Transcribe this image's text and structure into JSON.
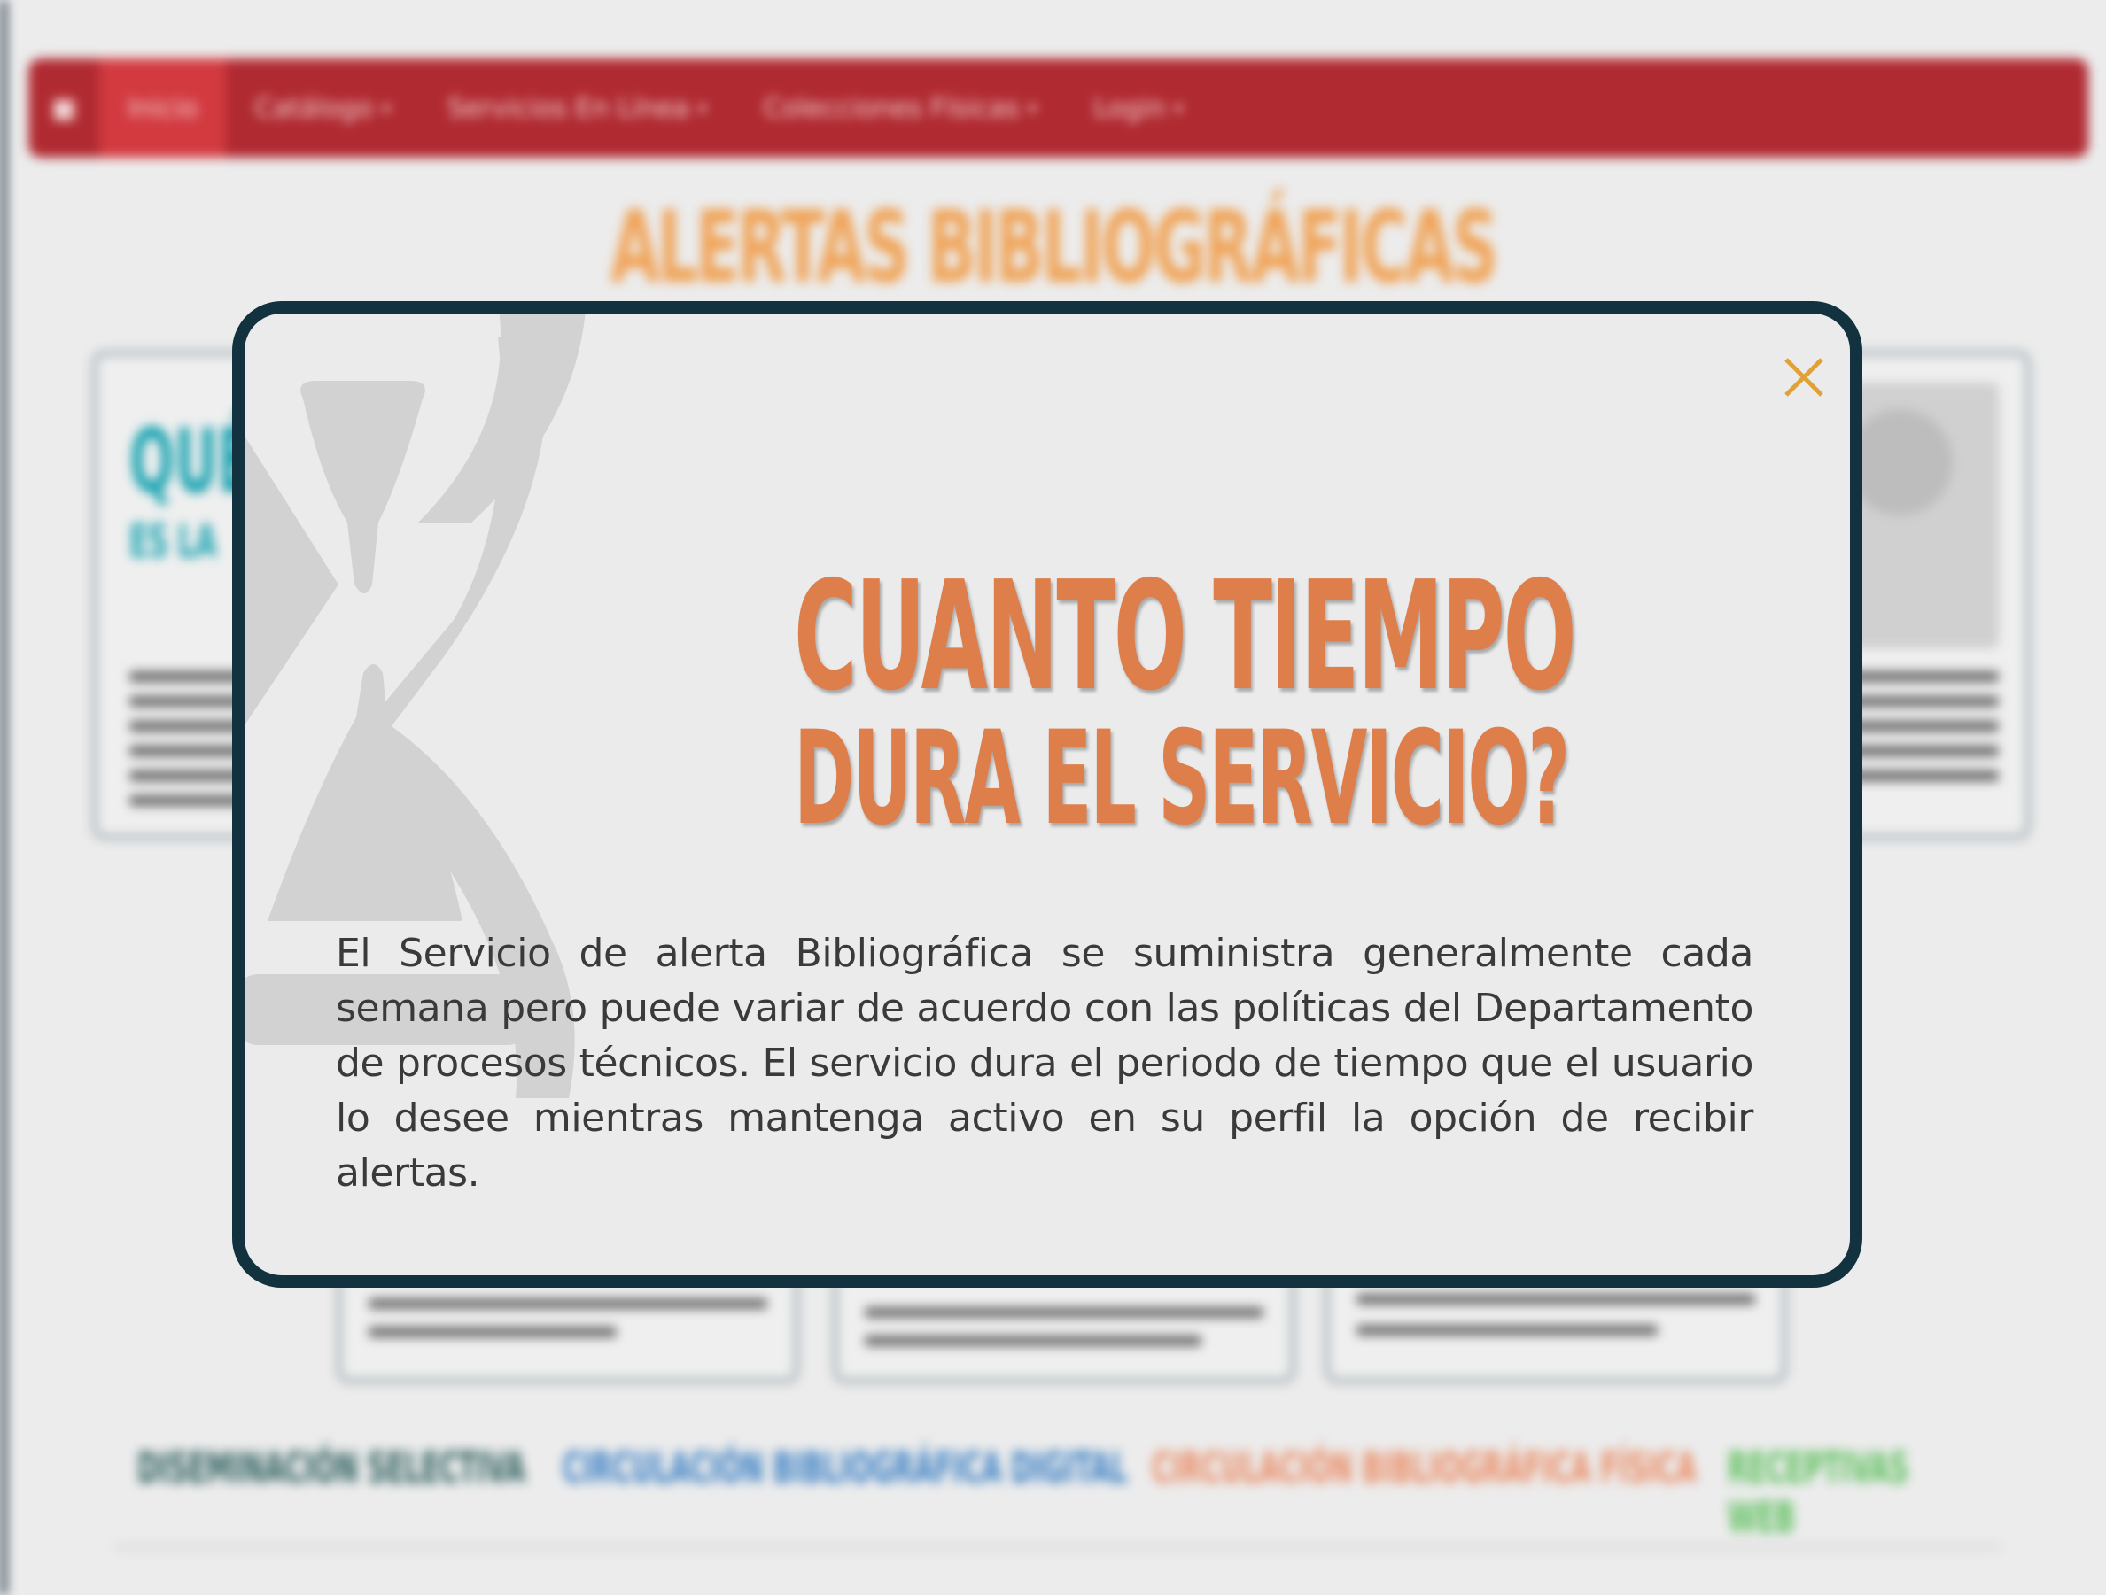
{
  "navbar": {
    "home_icon": "home-icon",
    "items": [
      {
        "label": "Inicio"
      },
      {
        "label": "Catálogo"
      },
      {
        "label": "Servicios En Línea"
      },
      {
        "label": "Colecciones Físicas"
      },
      {
        "label": "Login"
      }
    ]
  },
  "background": {
    "heading": "ALERTAS BIBLIOGRÁFICAS",
    "card_left_title": "QUÉ",
    "card_left_subtitle": "ES LA",
    "bottom_links": [
      {
        "label": "DISEMINACIÓN SELECTIVA"
      },
      {
        "label": "CIRCULACIÓN BIBLIOGRÁFICA DIGITAL"
      },
      {
        "label": "CIRCULACIÓN BIBLIOGRÁFICA FÍSICA"
      },
      {
        "label": "RECEPTIVAS WEB"
      }
    ]
  },
  "modal": {
    "title_line1": "CUANTO TIEMPO",
    "title_line2": "DURA EL SERVICIO?",
    "body": "El Servicio de alerta Bibliográfica se suministra generalmente cada semana pero puede variar de acuerdo con las políticas del Departamento de procesos técnicos. El servicio dura el periodo de tiempo que el usuario lo desee mientras mantenga activo en su perfil la opción de recibir alertas.",
    "close_icon": "close-icon",
    "decor_icon": "hourglass-icon"
  },
  "colors": {
    "navbar": "#b02a31",
    "modal_border": "#133240",
    "title": "#dd7e4b",
    "close": "#e2a135"
  }
}
